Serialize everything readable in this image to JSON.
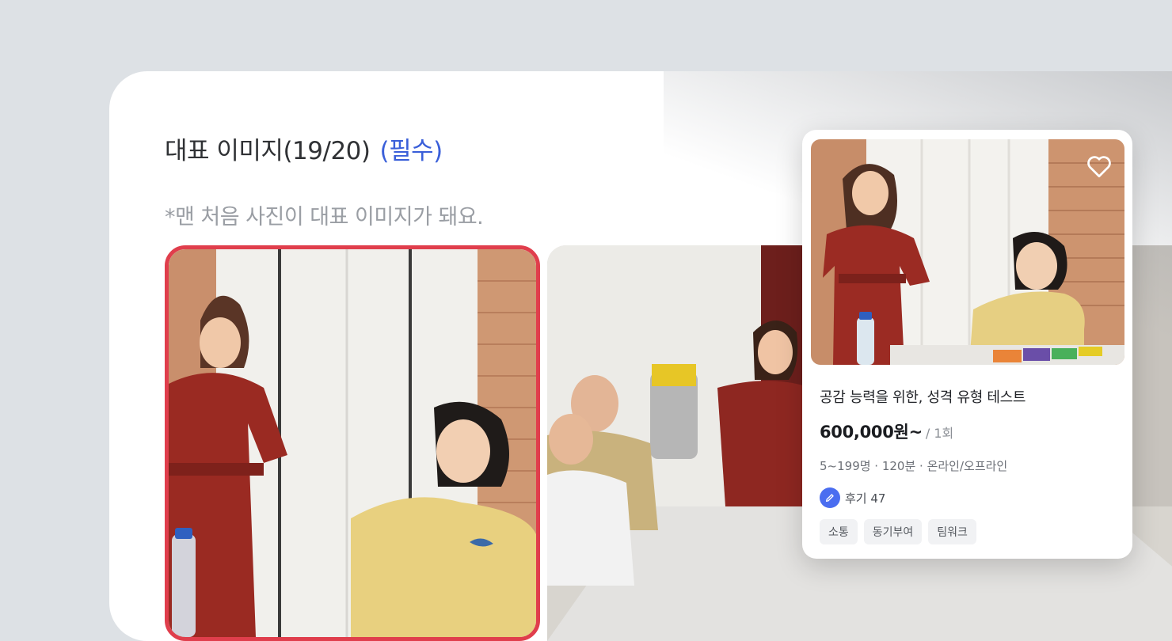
{
  "section": {
    "title": "대표 이미지(19/20)",
    "required_label": "(필수)",
    "hint": "*맨 처음 사진이 대표 이미지가 돼요."
  },
  "card": {
    "title": "공감 능력을 위한, 성격 유형 테스트",
    "price": "600,000원~",
    "per_unit": "/ 1회",
    "meta": "5~199명 · 120분 · 온라인/오프라인",
    "review_label": "후기 47",
    "tags": [
      "소통",
      "동기부여",
      "팀워크"
    ]
  },
  "colors": {
    "accent": "#3a5fd9",
    "selected_border": "#e03e4c",
    "review_badge": "#4a6df0"
  },
  "icons": [
    "heart-icon",
    "pencil-icon"
  ]
}
